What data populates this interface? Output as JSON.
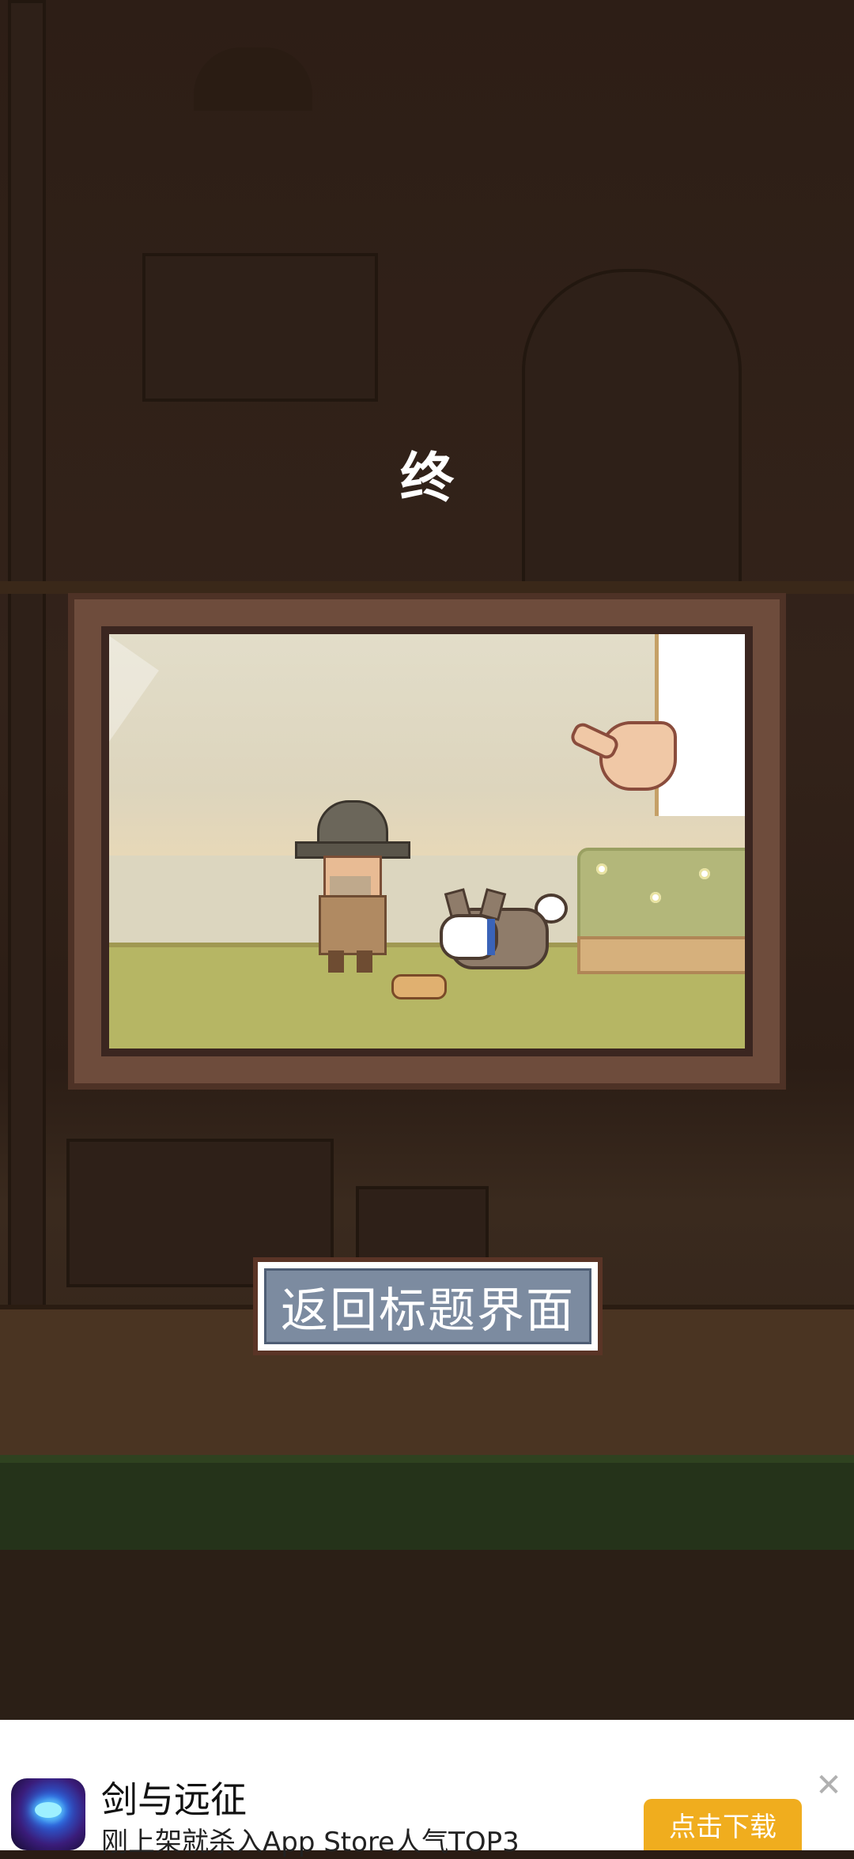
{
  "title_glyph": "终",
  "return_button": {
    "label": "返回标题界面"
  },
  "ad": {
    "title": "剑与远征",
    "description": "刚上架就杀入App Store人气TOP3",
    "download_label": "点击下载",
    "close_symbol": "✕"
  },
  "icons": {
    "close": "close-icon",
    "app": "app-icon"
  },
  "colors": {
    "button_fill": "#7c8ba0",
    "button_border": "#5a3426",
    "download_button": "#f0ad1e",
    "frame": "#6e4c3c"
  }
}
